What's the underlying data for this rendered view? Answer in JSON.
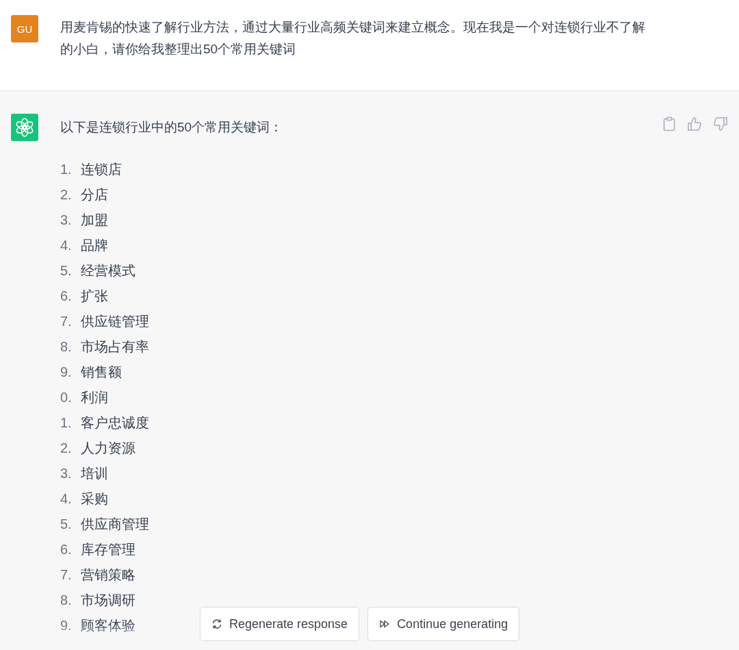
{
  "user_message": {
    "avatar": "GU",
    "text": "用麦肯锡的快速了解行业方法，通过大量行业高频关键词来建立概念。现在我是一个对连锁行业不了解的小白，请你给我整理出50个常用关键词"
  },
  "assistant_message": {
    "intro": "以下是连锁行业中的50个常用关键词：",
    "items": [
      {
        "number": "1.",
        "text": "连锁店"
      },
      {
        "number": "2.",
        "text": "分店"
      },
      {
        "number": "3.",
        "text": "加盟"
      },
      {
        "number": "4.",
        "text": "品牌"
      },
      {
        "number": "5.",
        "text": "经营模式"
      },
      {
        "number": "6.",
        "text": "扩张"
      },
      {
        "number": "7.",
        "text": "供应链管理"
      },
      {
        "number": "8.",
        "text": "市场占有率"
      },
      {
        "number": "9.",
        "text": "销售额"
      },
      {
        "number": "0.",
        "text": "利润"
      },
      {
        "number": "1.",
        "text": "客户忠诚度"
      },
      {
        "number": "2.",
        "text": "人力资源"
      },
      {
        "number": "3.",
        "text": "培训"
      },
      {
        "number": "4.",
        "text": "采购"
      },
      {
        "number": "5.",
        "text": "供应商管理"
      },
      {
        "number": "6.",
        "text": "库存管理"
      },
      {
        "number": "7.",
        "text": "营销策略"
      },
      {
        "number": "8.",
        "text": "市场调研"
      },
      {
        "number": "9.",
        "text": "顾客体验"
      }
    ]
  },
  "actions": [
    {
      "kind": "regenerate",
      "label": "Regenerate response"
    },
    {
      "kind": "continue",
      "label": "Continue generating"
    }
  ]
}
